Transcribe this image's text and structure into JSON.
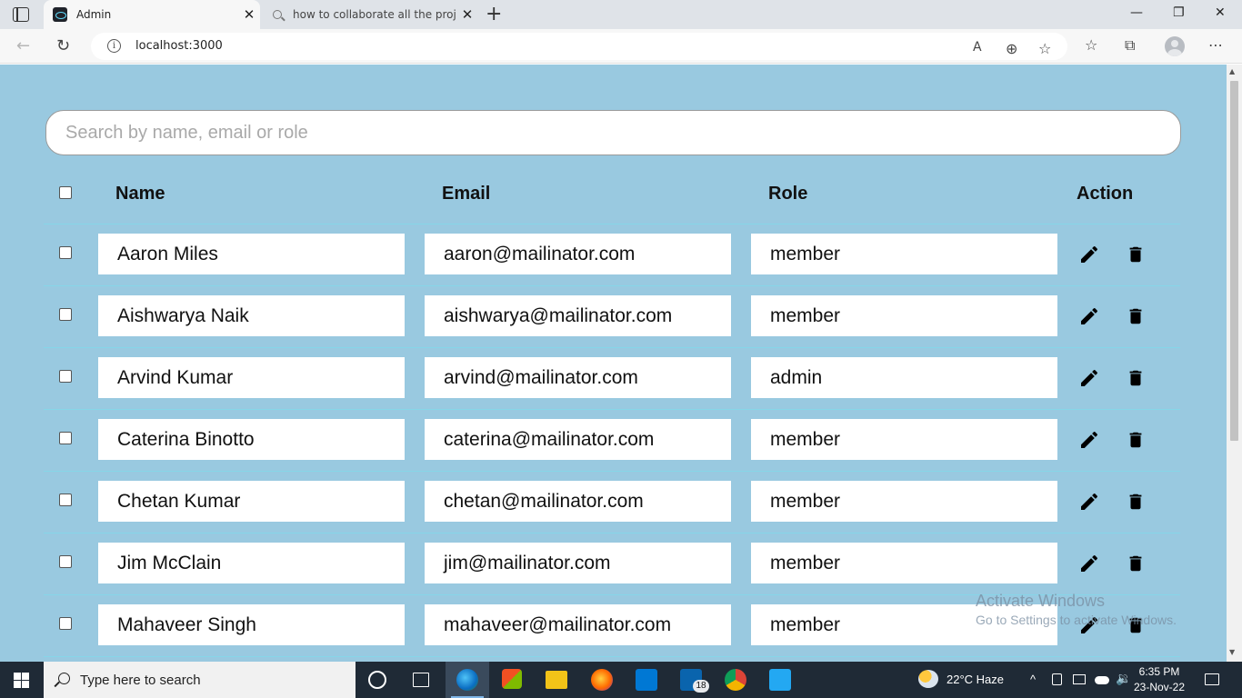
{
  "browser": {
    "active_tab_title": "Admin",
    "inactive_tab_title": "how to collaborate all the projec",
    "url": "localhost:3000",
    "tab_close_glyph": "✕",
    "new_tab_glyph": "+",
    "window_controls": {
      "minimize": "—",
      "restore": "❐",
      "close": "✕"
    },
    "nav": {
      "back": "←",
      "refresh": "↻"
    },
    "address_icons": {
      "read_aloud": "A",
      "zoom": "⊕",
      "add_favorite": "☆",
      "favorites": "☆",
      "collections": "⧉",
      "more": "⋯"
    }
  },
  "search": {
    "placeholder": "Search by name, email or role",
    "value": ""
  },
  "table": {
    "headers": {
      "name": "Name",
      "email": "Email",
      "role": "Role",
      "action": "Action"
    },
    "rows": [
      {
        "name": "Aaron Miles",
        "email": "aaron@mailinator.com",
        "role": "member"
      },
      {
        "name": "Aishwarya Naik",
        "email": "aishwarya@mailinator.com",
        "role": "member"
      },
      {
        "name": "Arvind Kumar",
        "email": "arvind@mailinator.com",
        "role": "admin"
      },
      {
        "name": "Caterina Binotto",
        "email": "caterina@mailinator.com",
        "role": "member"
      },
      {
        "name": "Chetan Kumar",
        "email": "chetan@mailinator.com",
        "role": "member"
      },
      {
        "name": "Jim McClain",
        "email": "jim@mailinator.com",
        "role": "member"
      },
      {
        "name": "Mahaveer Singh",
        "email": "mahaveer@mailinator.com",
        "role": "member"
      }
    ]
  },
  "watermark": {
    "line1": "Activate Windows",
    "line2": "Go to Settings to activate Windows."
  },
  "taskbar": {
    "search_placeholder": "Type here to search",
    "weather": "22°C  Haze",
    "mail_badge": "18",
    "time": "6:35 PM",
    "date": "23-Nov-22",
    "tray_chevron": "^"
  },
  "colors": {
    "page_bg": "#99c9e0",
    "row_divider": "#86d6e8",
    "icon": "#000000"
  }
}
